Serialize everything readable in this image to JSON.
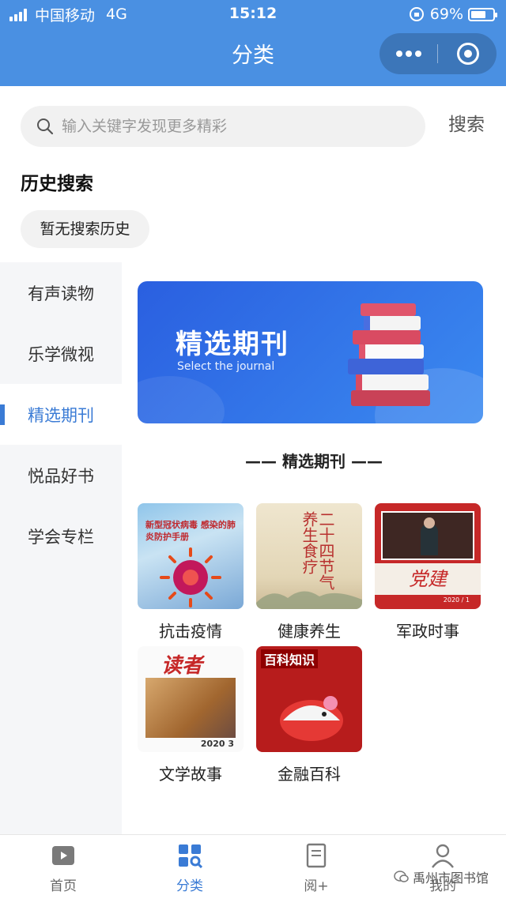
{
  "status_bar": {
    "carrier": "中国移动",
    "network": "4G",
    "time": "15:12",
    "battery": "69%",
    "battery_level": 0.69
  },
  "nav": {
    "title": "分类"
  },
  "search": {
    "placeholder": "输入关键字发现更多精彩",
    "button": "搜索"
  },
  "history": {
    "title": "历史搜索",
    "empty": "暂无搜索历史"
  },
  "sidebar": {
    "items": [
      {
        "label": "有声读物"
      },
      {
        "label": "乐学微视"
      },
      {
        "label": "精选期刊"
      },
      {
        "label": "悦品好书"
      },
      {
        "label": "学会专栏"
      }
    ],
    "active_index": 2
  },
  "banner": {
    "title": "精选期刊",
    "subtitle": "Select the journal"
  },
  "section": {
    "title": "—— 精选期刊 ——"
  },
  "journals": [
    {
      "label": "抗击疫情",
      "cover_title": "新型冠状病毒 感染的肺炎防护手册"
    },
    {
      "label": "健康养生",
      "cover_title": "二十四节气 养生食疗"
    },
    {
      "label": "军政时事",
      "cover_title": "党建",
      "cover_date": "2020 / 1"
    },
    {
      "label": "文学故事",
      "cover_title": "读者",
      "cover_date": "2020 3"
    },
    {
      "label": "金融百科",
      "cover_title": "百科知识"
    }
  ],
  "tabbar": {
    "items": [
      {
        "label": "首页"
      },
      {
        "label": "分类"
      },
      {
        "label": "阅+"
      },
      {
        "label": "我的"
      }
    ],
    "active_index": 1
  },
  "watermark": {
    "text": "禹州市图书馆"
  },
  "colors": {
    "primary": "#4a90e2",
    "accent": "#3a7bd5",
    "sidebar_bg": "#f5f6f8"
  }
}
